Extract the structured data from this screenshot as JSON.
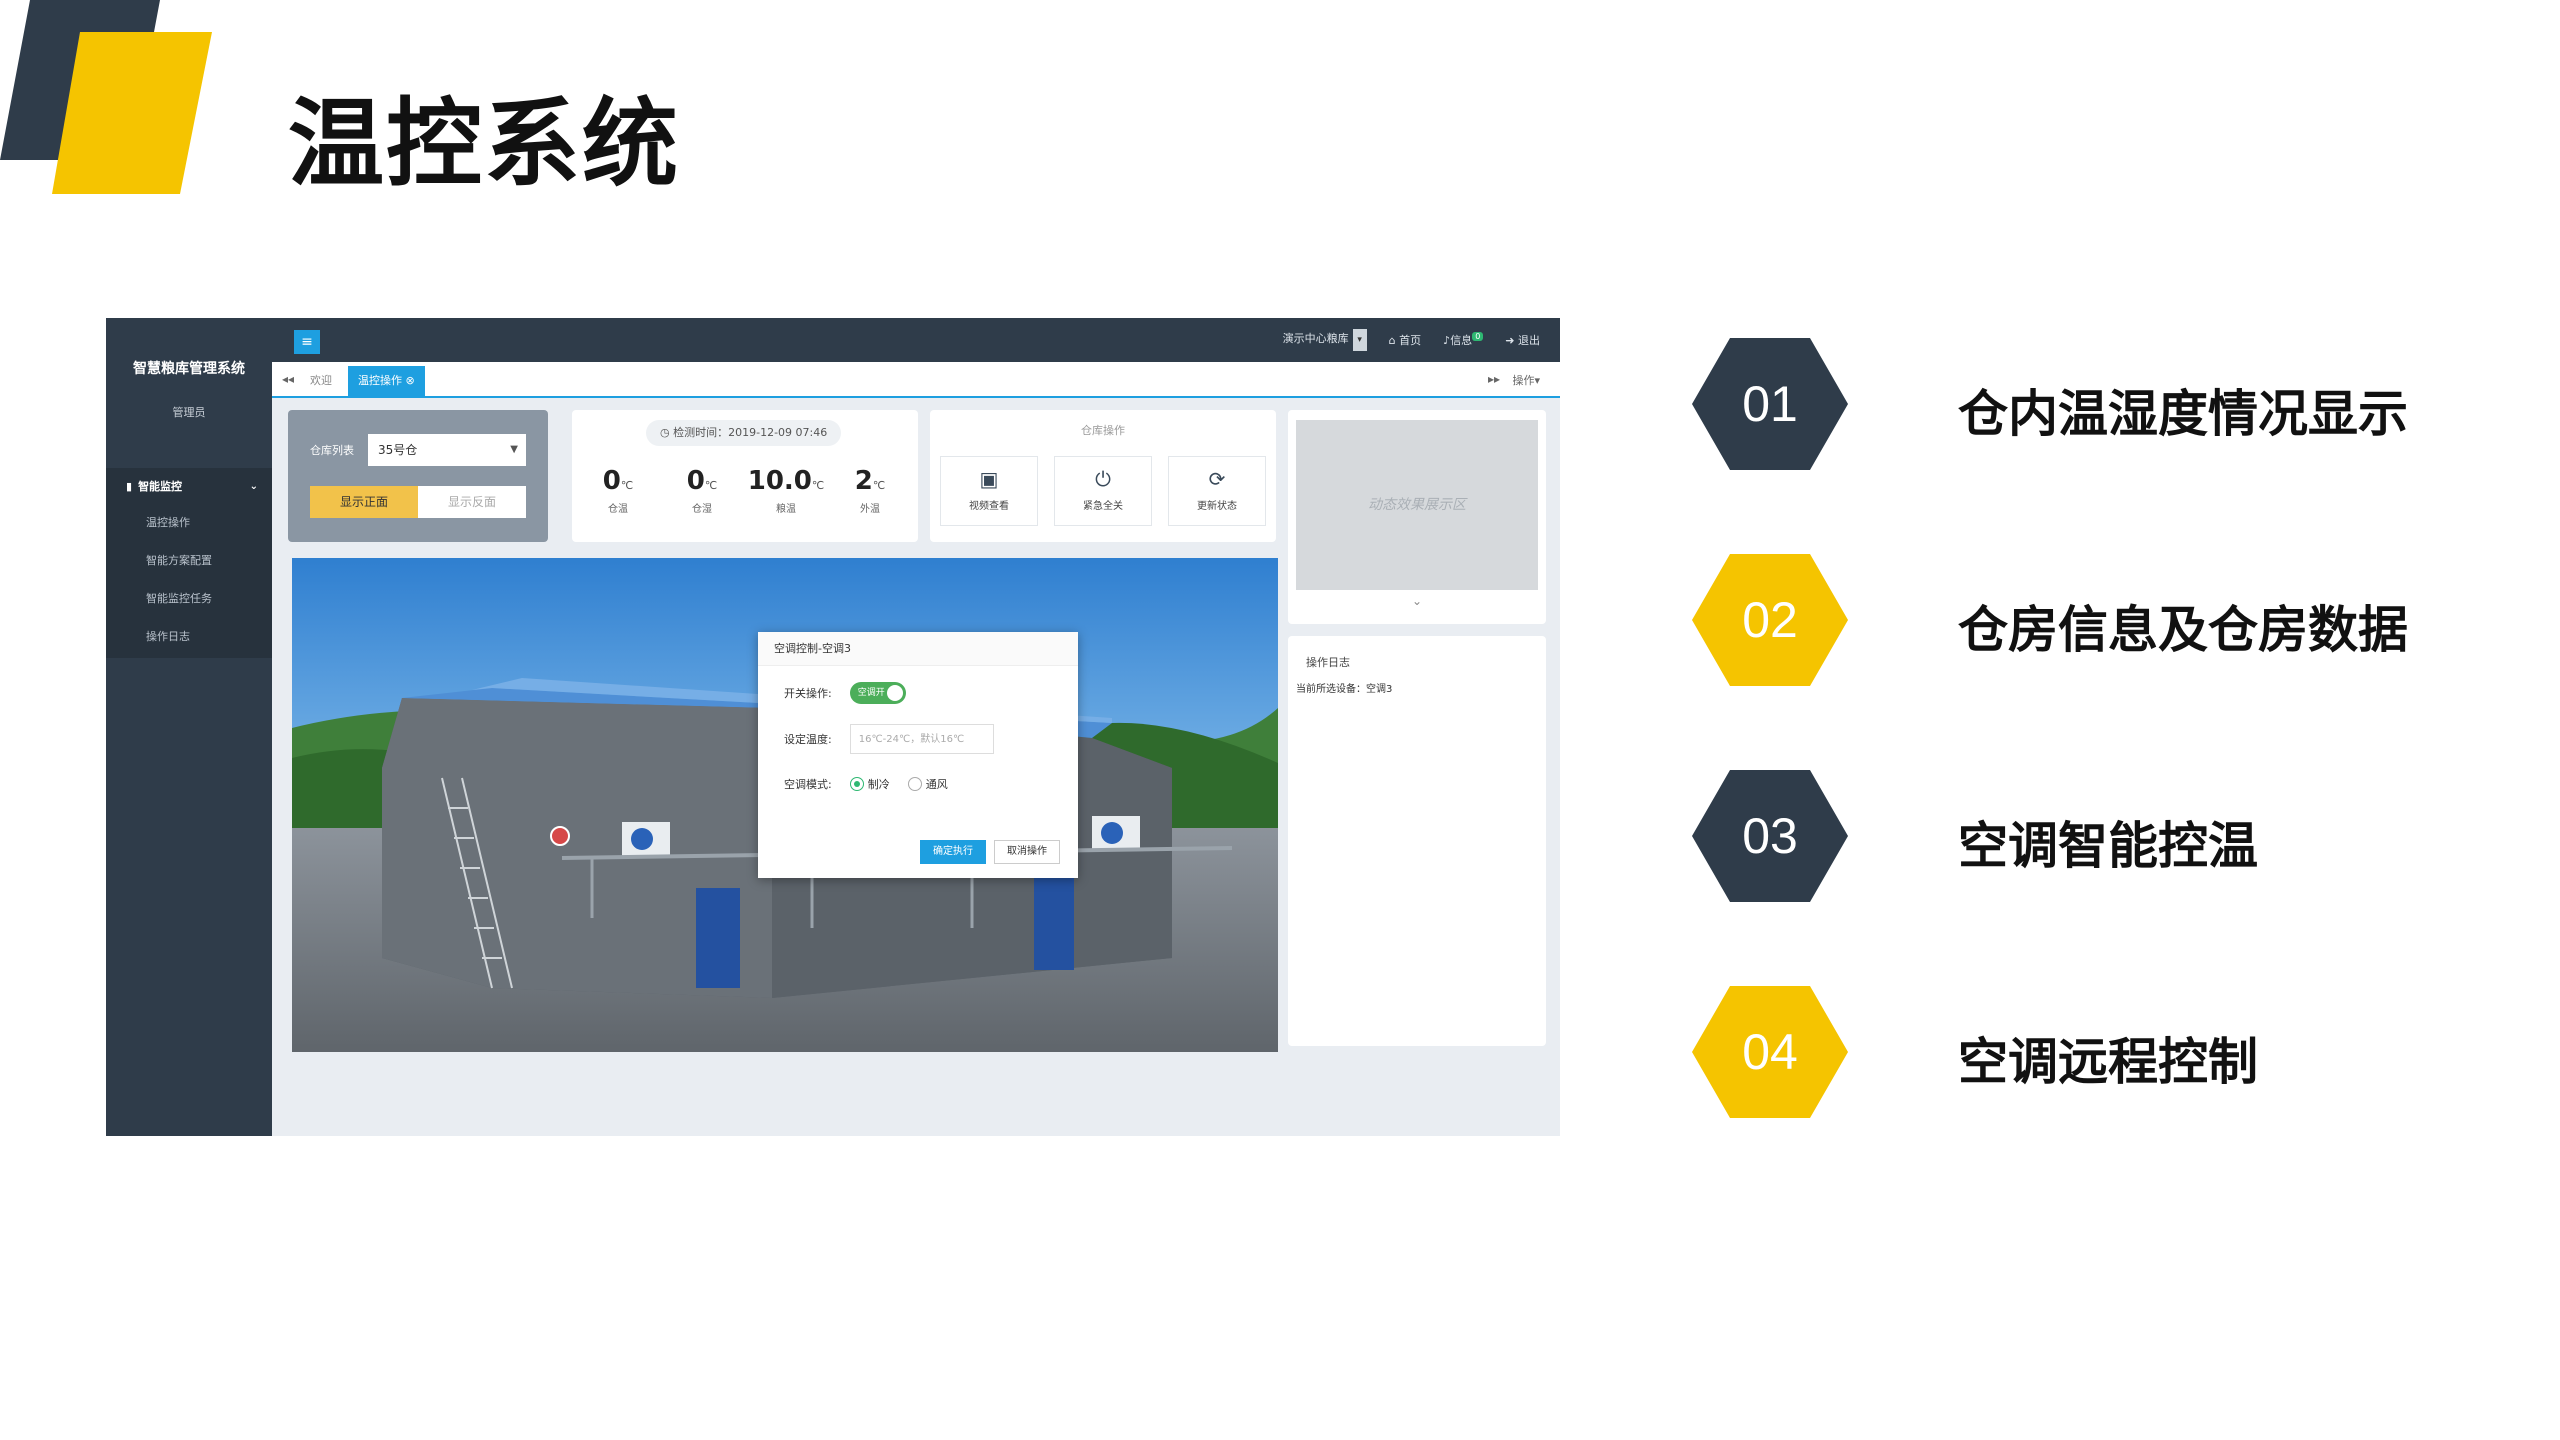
{
  "slide": {
    "title": "温控系统"
  },
  "colors": {
    "accent_yellow": "#f5c400",
    "navy": "#2f3c4a",
    "blue": "#1e9fe0"
  },
  "app": {
    "system_name": "智慧粮库管理系统",
    "user_role": "管理员",
    "menu_toggle_icon": "≡",
    "sidebar": {
      "group": "智能监控",
      "items": [
        "温控操作",
        "智能方案配置",
        "智能监控任务",
        "操作日志"
      ]
    },
    "topbar": {
      "depot": "演示中心粮库",
      "home": "首页",
      "messages": "信息",
      "message_badge": "0",
      "logout": "退出"
    },
    "tabs": {
      "welcome": "欢迎",
      "active": "温控操作",
      "ops": "操作▾"
    },
    "warehouse": {
      "list_label": "仓库列表",
      "selected": "35号仓",
      "front_btn": "显示正面",
      "back_btn": "显示反面"
    },
    "readings": {
      "time_label": "检测时间：2019-12-09 07:46",
      "items": [
        {
          "value": "0",
          "unit": "℃",
          "label": "仓温"
        },
        {
          "value": "0",
          "unit": "℃",
          "label": "仓湿"
        },
        {
          "value": "10.0",
          "unit": "℃",
          "label": "粮温"
        },
        {
          "value": "2",
          "unit": "℃",
          "label": "外温"
        }
      ]
    },
    "warehouse_ops": {
      "title": "仓库操作",
      "buttons": [
        {
          "icon": "video-icon",
          "glyph": "▣",
          "label": "视频查看"
        },
        {
          "icon": "power-icon",
          "glyph": "⏻",
          "label": "紧急全关"
        },
        {
          "icon": "refresh-icon",
          "glyph": "⟳",
          "label": "更新状态"
        }
      ]
    },
    "animation_area": "动态效果展示区",
    "log": {
      "title": "操作日志",
      "line": "当前所选设备：空调3"
    },
    "dialog": {
      "title": "空调控制-空调3",
      "switch_label": "开关操作:",
      "switch_state": "空调开",
      "temp_label": "设定温度:",
      "temp_placeholder": "16℃-24℃，默认16℃",
      "mode_label": "空调模式:",
      "mode_cool": "制冷",
      "mode_fan": "通风",
      "confirm": "确定执行",
      "cancel": "取消操作"
    }
  },
  "features": [
    {
      "num": "01",
      "label": "仓内温湿度情况显示",
      "color": "#2f3c4a"
    },
    {
      "num": "02",
      "label": "仓房信息及仓房数据",
      "color": "#f5c400"
    },
    {
      "num": "03",
      "label": "空调智能控温",
      "color": "#2f3c4a"
    },
    {
      "num": "04",
      "label": "空调远程控制",
      "color": "#f5c400"
    }
  ]
}
